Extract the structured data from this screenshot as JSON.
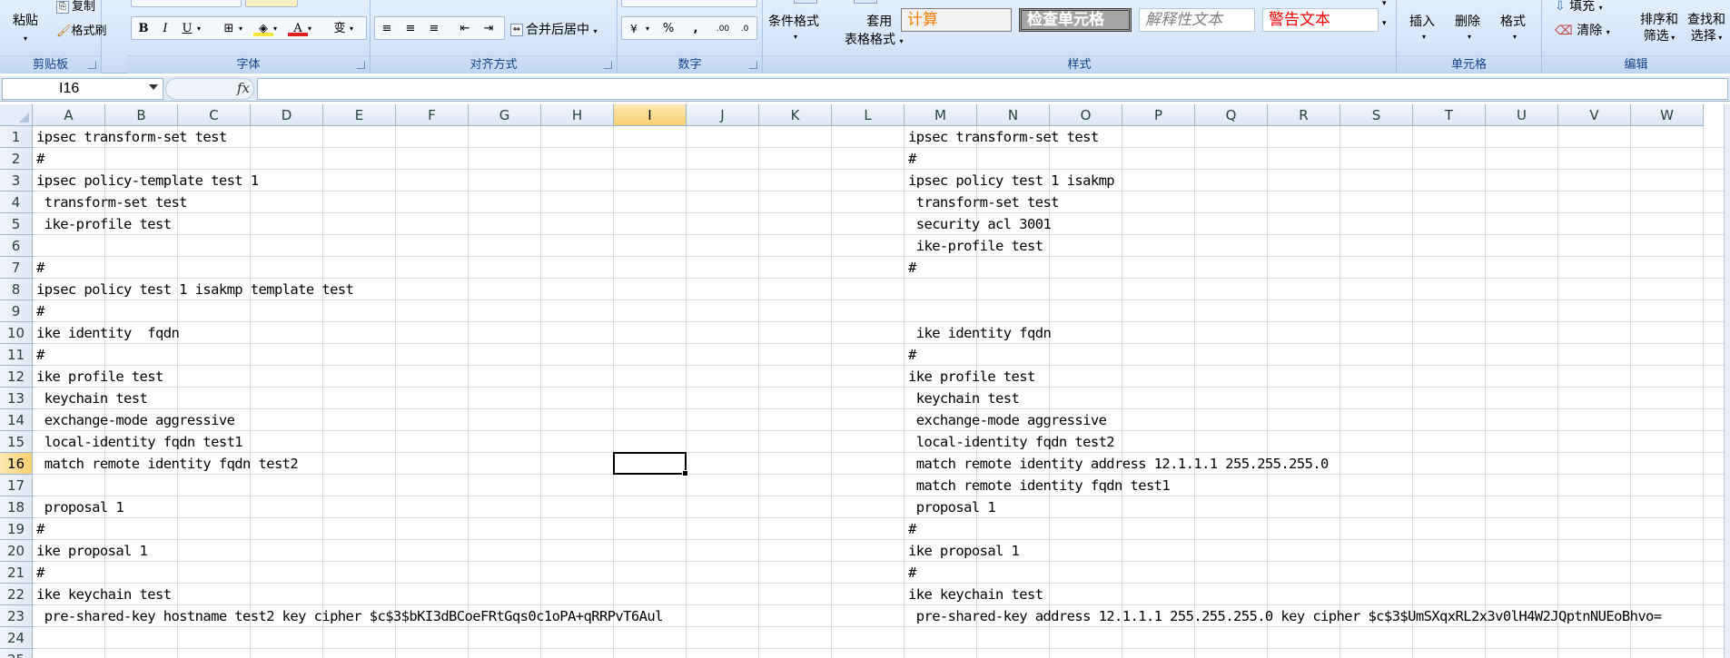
{
  "ribbon": {
    "clipboard": {
      "paste_label": "粘贴",
      "copy_label": "复制",
      "format_painter_label": "格式刷",
      "group_label": "剪贴板"
    },
    "font": {
      "bold": "B",
      "italic": "I",
      "underline": "U",
      "font_color_glyph": "A",
      "phonetic_glyph": "变",
      "group_label": "字体"
    },
    "alignment": {
      "merge_center_label": "合并后居中",
      "group_label": "对齐方式"
    },
    "number": {
      "percent": "%",
      "comma": ",",
      "group_label": "数字"
    },
    "styles": {
      "conditional_format_label": "条件格式",
      "table_format_label_1": "套用",
      "table_format_label_2": "表格格式",
      "style_calc": "计算",
      "style_check": "检查单元格",
      "style_explain": "解释性文本",
      "style_warning": "警告文本",
      "group_label": "样式"
    },
    "cells": {
      "insert_label": "插入",
      "delete_label": "删除",
      "format_label": "格式",
      "group_label": "单元格"
    },
    "editing": {
      "fill_label": "填充",
      "clear_label": "清除",
      "sort_filter_label_1": "排序和",
      "sort_filter_label_2": "筛选",
      "find_select_label_1": "查找和",
      "find_select_label_2": "选择",
      "group_label": "编辑"
    }
  },
  "formula_bar": {
    "name_box": "I16",
    "fx": "fx",
    "formula_value": ""
  },
  "grid": {
    "columns": [
      "A",
      "B",
      "C",
      "D",
      "E",
      "F",
      "G",
      "H",
      "I",
      "J",
      "K",
      "L",
      "M",
      "N",
      "O",
      "P",
      "Q",
      "R",
      "S",
      "T",
      "U",
      "V",
      "W"
    ],
    "selected_column": "I",
    "selected_row": "16",
    "rows": [
      "1",
      "2",
      "3",
      "4",
      "5",
      "6",
      "7",
      "8",
      "9",
      "10",
      "11",
      "12",
      "13",
      "14",
      "15",
      "16",
      "17",
      "18",
      "19",
      "20",
      "21",
      "22",
      "23",
      "24",
      "25"
    ],
    "col_a_text": [
      "ipsec transform-set test",
      "#",
      "ipsec policy-template test 1",
      " transform-set test",
      " ike-profile test",
      "",
      "#",
      "ipsec policy test 1 isakmp template test",
      "#",
      "ike identity  fqdn",
      "#",
      "ike profile test",
      " keychain test",
      " exchange-mode aggressive",
      " local-identity fqdn test1",
      " match remote identity fqdn test2",
      "",
      " proposal 1",
      "#",
      "ike proposal 1",
      "#",
      "ike keychain test",
      " pre-shared-key hostname test2 key cipher $c$3$bKI3dBCoeFRtGqs0c1oPA+qRRPvT6Aul",
      "",
      ""
    ],
    "col_m_text": [
      "ipsec transform-set test",
      "#",
      "ipsec policy test 1 isakmp",
      " transform-set test",
      " security acl 3001",
      " ike-profile test",
      "#",
      "",
      "",
      " ike identity fqdn",
      "#",
      "ike profile test",
      " keychain test",
      " exchange-mode aggressive",
      " local-identity fqdn test2",
      " match remote identity address 12.1.1.1 255.255.255.0",
      " match remote identity fqdn test1",
      " proposal 1",
      "#",
      "ike proposal 1",
      "#",
      "ike keychain test",
      " pre-shared-key address 12.1.1.1 255.255.255.0 key cipher $c$3$UmSXqxRL2x3v0lH4W2JQptnNUEoBhvo=",
      "",
      ""
    ]
  }
}
